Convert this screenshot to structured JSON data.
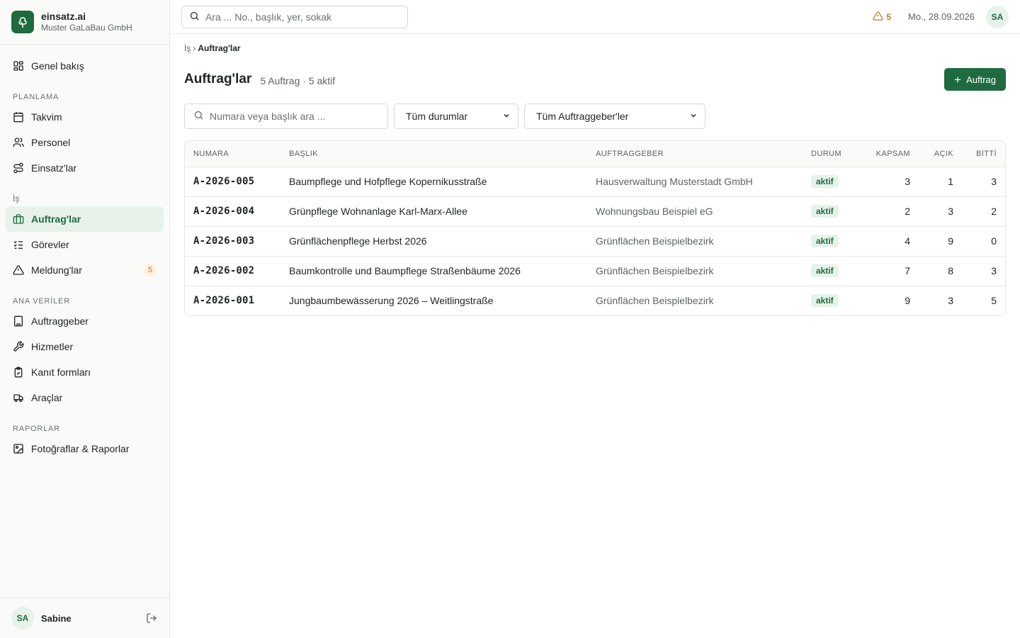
{
  "brand": {
    "name": "einsatz.ai",
    "company": "Muster GaLaBau GmbH"
  },
  "sidebar": {
    "overview": {
      "label": "Genel bakış",
      "icon": "dashboard-icon"
    },
    "sections": [
      {
        "title": "PLANLAMA",
        "items": [
          {
            "label": "Takvim",
            "icon": "calendar-icon"
          },
          {
            "label": "Personel",
            "icon": "users-icon"
          },
          {
            "label": "Einsatz'lar",
            "icon": "route-icon"
          }
        ]
      },
      {
        "title": "İş",
        "items": [
          {
            "label": "Auftrag'lar",
            "icon": "briefcase-icon",
            "active": true
          },
          {
            "label": "Görevler",
            "icon": "checklist-icon"
          },
          {
            "label": "Meldung'lar",
            "icon": "warning-icon",
            "count": "5"
          }
        ]
      },
      {
        "title": "ANA VERİLER",
        "items": [
          {
            "label": "Auftraggeber",
            "icon": "building-icon"
          },
          {
            "label": "Hizmetler",
            "icon": "wrench-icon"
          },
          {
            "label": "Kanıt formları",
            "icon": "clipboard-icon"
          },
          {
            "label": "Araçlar",
            "icon": "truck-icon"
          }
        ]
      },
      {
        "title": "RAPORLAR",
        "items": [
          {
            "label": "Fotoğraflar & Raporlar",
            "icon": "image-icon"
          }
        ]
      }
    ],
    "user": {
      "initials": "SA",
      "name": "Sabine"
    }
  },
  "topbar": {
    "search_placeholder": "Ara ... No., başlık, yer, sokak",
    "alert_count": "5",
    "date": "Mo., 28.09.2026",
    "user_initials": "SA"
  },
  "breadcrumb": {
    "parent": "İş",
    "separator": "›",
    "current": "Auftrag'lar"
  },
  "page": {
    "title": "Auftrag'lar",
    "meta": "5 Auftrag · 5 aktif",
    "add_button": "Auftrag"
  },
  "filters": {
    "search_placeholder": "Numara veya başlık ara ...",
    "status_selected": "Tüm durumlar",
    "client_selected": "Tüm Auftraggeber'ler"
  },
  "table": {
    "columns": [
      "NUMARA",
      "BAŞLIK",
      "AUFTRAGGEBER",
      "DURUM",
      "KAPSAM",
      "AÇIK",
      "BİTTİ"
    ],
    "rows": [
      {
        "number": "A-2026-005",
        "title": "Baumpflege und Hofpflege Kopernikusstraße",
        "client": "Hausverwaltung Musterstadt GmbH",
        "status": "aktif",
        "scope": "3",
        "open": "1",
        "done": "3"
      },
      {
        "number": "A-2026-004",
        "title": "Grünpflege Wohnanlage Karl-Marx-Allee",
        "client": "Wohnungsbau Beispiel eG",
        "status": "aktif",
        "scope": "2",
        "open": "3",
        "done": "2"
      },
      {
        "number": "A-2026-003",
        "title": "Grünflächenpflege Herbst 2026",
        "client": "Grünflächen Beispielbezirk",
        "status": "aktif",
        "scope": "4",
        "open": "9",
        "done": "0"
      },
      {
        "number": "A-2026-002",
        "title": "Baumkontrolle und Baumpflege Straßenbäume 2026",
        "client": "Grünflächen Beispielbezirk",
        "status": "aktif",
        "scope": "7",
        "open": "8",
        "done": "3"
      },
      {
        "number": "A-2026-001",
        "title": "Jungbaumbewässerung 2026 – Weitlingstraße",
        "client": "Grünflächen Beispielbezirk",
        "status": "aktif",
        "scope": "9",
        "open": "3",
        "done": "5"
      }
    ]
  },
  "colors": {
    "brand": "#1f6b3f",
    "active_bg": "#e6f2ea",
    "warning": "#b7791f"
  }
}
